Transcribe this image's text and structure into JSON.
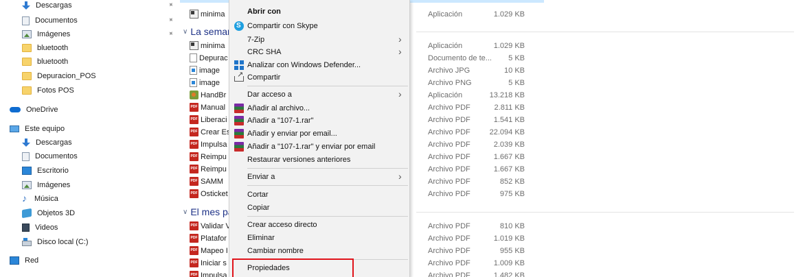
{
  "sidebar": {
    "items": [
      {
        "label": "Descargas",
        "icon": "download-arrow-icon",
        "pinned": true
      },
      {
        "label": "Documentos",
        "icon": "documents-icon",
        "pinned": true
      },
      {
        "label": "Imágenes",
        "icon": "pictures-icon",
        "pinned": true
      },
      {
        "label": "bluetooth",
        "icon": "folder-icon"
      },
      {
        "label": "bluetooth",
        "icon": "folder-icon"
      },
      {
        "label": "Depuracion_POS",
        "icon": "folder-icon"
      },
      {
        "label": "Fotos POS",
        "icon": "folder-icon"
      },
      {
        "label": "OneDrive",
        "icon": "onedrive-cloud-icon"
      },
      {
        "label": "Este equipo",
        "icon": "this-pc-icon"
      },
      {
        "label": "Descargas",
        "icon": "download-arrow-icon"
      },
      {
        "label": "Documentos",
        "icon": "documents-icon"
      },
      {
        "label": "Escritorio",
        "icon": "desktop-icon"
      },
      {
        "label": "Imágenes",
        "icon": "pictures-icon"
      },
      {
        "label": "Música",
        "icon": "music-icon"
      },
      {
        "label": "Objetos 3D",
        "icon": "3d-objects-icon"
      },
      {
        "label": "Videos",
        "icon": "videos-icon"
      },
      {
        "label": "Disco local (C:)",
        "icon": "local-disk-icon"
      },
      {
        "label": "Red",
        "icon": "network-icon"
      }
    ]
  },
  "files": {
    "groups": [
      {
        "title": "La semana pasada"
      },
      {
        "title": "El mes pasado"
      }
    ],
    "rows": [
      {
        "name": "minima",
        "type": "Aplicación",
        "size": "1.029 KB",
        "icon": "application-icon"
      },
      {
        "name": "minima",
        "type": "Aplicación",
        "size": "1.029 KB",
        "icon": "application-icon"
      },
      {
        "name": "Depurac",
        "type": "Documento de te...",
        "size": "5 KB",
        "icon": "text-document-icon"
      },
      {
        "name": "image",
        "type": "Archivo JPG",
        "size": "10 KB",
        "icon": "image-file-icon"
      },
      {
        "name": "image",
        "type": "Archivo PNG",
        "size": "5 KB",
        "icon": "image-file-icon"
      },
      {
        "name": "HandBr",
        "type": "Aplicación",
        "size": "13.218 KB",
        "icon": "handbrake-app-icon"
      },
      {
        "name": "Manual",
        "type": "Archivo PDF",
        "size": "2.811 KB",
        "icon": "pdf-file-icon"
      },
      {
        "name": "Liberaci",
        "type": "Archivo PDF",
        "size": "1.541 KB",
        "icon": "pdf-file-icon"
      },
      {
        "name": "Crear Es",
        "type": "Archivo PDF",
        "size": "22.094 KB",
        "icon": "pdf-file-icon"
      },
      {
        "name": "Impulsa",
        "type": "Archivo PDF",
        "size": "2.039 KB",
        "icon": "pdf-file-icon"
      },
      {
        "name": "Reimpu",
        "type": "Archivo PDF",
        "size": "1.667 KB",
        "icon": "pdf-file-icon"
      },
      {
        "name": "Reimpu",
        "type": "Archivo PDF",
        "size": "1.667 KB",
        "icon": "pdf-file-icon"
      },
      {
        "name": "SAMM",
        "type": "Archivo PDF",
        "size": "852 KB",
        "icon": "pdf-file-icon"
      },
      {
        "name": "Osticket",
        "type": "Archivo PDF",
        "size": "975 KB",
        "icon": "pdf-file-icon"
      },
      {
        "name": "Validar V",
        "type": "Archivo PDF",
        "size": "810 KB",
        "icon": "pdf-file-icon"
      },
      {
        "name": "Platafor",
        "type": "Archivo PDF",
        "size": "1.019 KB",
        "icon": "pdf-file-icon"
      },
      {
        "name": "Mapeo I",
        "type": "Archivo PDF",
        "size": "955 KB",
        "icon": "pdf-file-icon"
      },
      {
        "name": "Iniciar s",
        "type": "Archivo PDF",
        "size": "1.009 KB",
        "icon": "pdf-file-icon"
      },
      {
        "name": "Impulsa",
        "type": "Archivo PDF",
        "size": "1.482 KB",
        "icon": "pdf-file-icon"
      }
    ]
  },
  "context_menu": {
    "items": [
      {
        "label": "Abrir con",
        "bold": true
      },
      {
        "label": "Compartir con Skype",
        "icon": "skype-icon"
      },
      {
        "label": "7-Zip",
        "submenu": true
      },
      {
        "label": "CRC SHA",
        "submenu": true
      },
      {
        "label": "Analizar con Windows Defender...",
        "icon": "windows-defender-icon"
      },
      {
        "label": "Compartir",
        "icon": "share-icon"
      },
      {
        "label": "Dar acceso a",
        "submenu": true
      },
      {
        "label": "Añadir al archivo...",
        "icon": "winrar-icon"
      },
      {
        "label": "Añadir a \"107-1.rar\"",
        "icon": "winrar-icon"
      },
      {
        "label": "Añadir y enviar por email...",
        "icon": "winrar-icon"
      },
      {
        "label": "Añadir a \"107-1.rar\" y enviar por email",
        "icon": "winrar-icon"
      },
      {
        "label": "Restaurar versiones anteriores"
      },
      {
        "label": "Enviar a",
        "submenu": true
      },
      {
        "label": "Cortar"
      },
      {
        "label": "Copiar"
      },
      {
        "label": "Crear acceso directo"
      },
      {
        "label": "Eliminar"
      },
      {
        "label": "Cambiar nombre"
      },
      {
        "label": "Propiedades",
        "highlighted": true
      }
    ]
  },
  "colors": {
    "highlight_border": "#e0131a",
    "group_header": "#1e3287",
    "menu_background": "#f2f2f2"
  }
}
